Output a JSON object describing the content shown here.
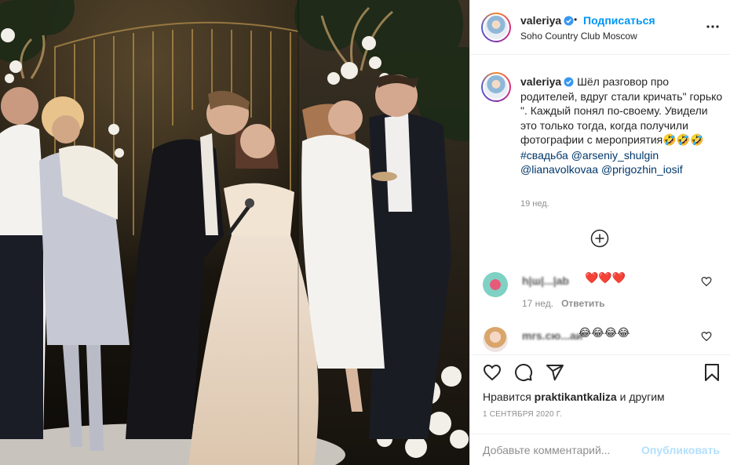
{
  "post": {
    "username": "valeriya",
    "follow_label": "Подписаться",
    "dot": "•",
    "location": "Soho Country Club Moscow",
    "photo_description_icon": "wedding-photo"
  },
  "caption": {
    "username": "valeriya",
    "text": "Шёл разговор про родителей, вдруг стали кричать\" горько \". Каждый понял по-своему. Увидели это только тогда, когда получили фотографии с мероприятия",
    "emojis": "🤣🤣🤣",
    "hashtag": "#свадьба",
    "mentions": [
      "@arseniy_shulgin",
      "@lianavolkovaa",
      "@prigozhin_iosif"
    ],
    "time": "19 нед."
  },
  "comments": [
    {
      "username": "h|ш|...|ab",
      "text": "❤️❤️❤️",
      "time": "17 нед.",
      "reply_label": "Ответить"
    },
    {
      "username": "mrs.сю...аи",
      "text": "😂😂😂😂",
      "time": "",
      "reply_label": ""
    }
  ],
  "footer": {
    "likes_prefix": "Нравится ",
    "likes_user": "praktikantkaliza",
    "likes_suffix": " и другим",
    "date": "1 сентября 2020 г.",
    "comment_placeholder": "Добавьте комментарий...",
    "publish_label": "Опубликовать"
  },
  "colors": {
    "accent": "#0095f6",
    "publish_disabled": "#b2dffc",
    "muted": "#8e8e8e",
    "heart": "#ed4956"
  }
}
